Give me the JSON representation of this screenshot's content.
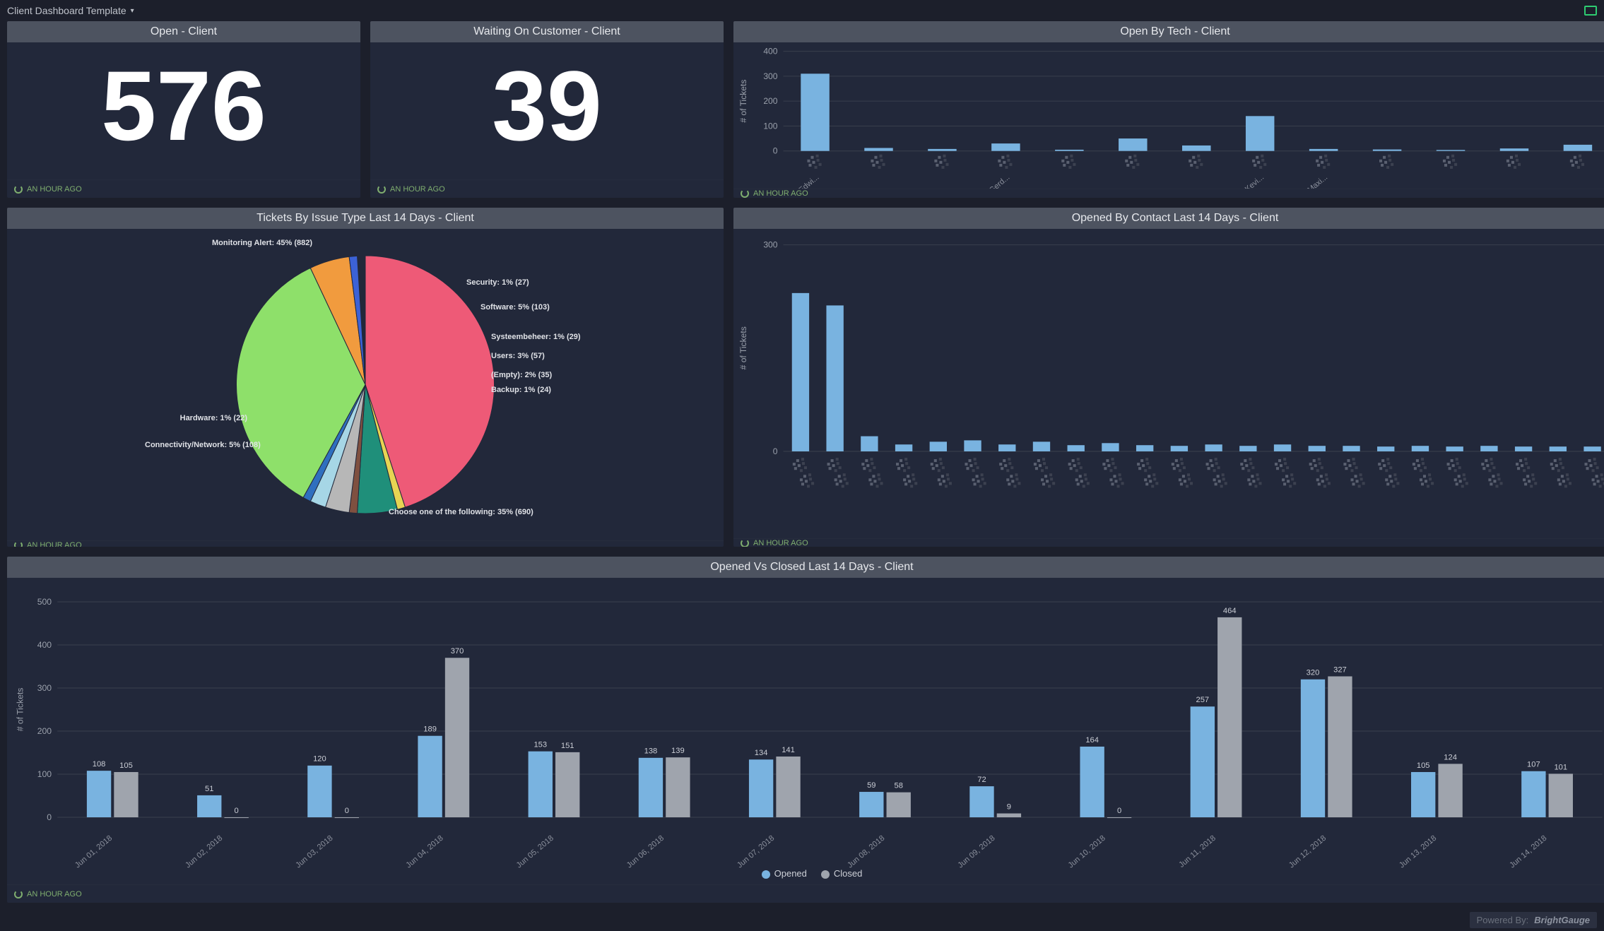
{
  "topbar": {
    "title": "Client Dashboard Template"
  },
  "footer_time": "AN HOUR AGO",
  "powered_by_label": "Powered By:",
  "powered_by_brand": "BrightGauge",
  "cards": {
    "open_client": {
      "title": "Open - Client",
      "value": "576"
    },
    "waiting": {
      "title": "Waiting On Customer - Client",
      "value": "39"
    },
    "open_by_tech": {
      "title": "Open By Tech - Client"
    },
    "issue_type": {
      "title": "Tickets By Issue Type Last 14 Days - Client"
    },
    "by_contact": {
      "title": "Opened By Contact Last 14 Days - Client"
    },
    "open_vs_closed": {
      "title": "Opened Vs Closed Last 14 Days - Client"
    }
  },
  "chart_data": [
    {
      "id": "open_by_tech",
      "type": "bar",
      "ylabel": "# of Tickets",
      "yticks": [
        0,
        100,
        200,
        300,
        400
      ],
      "ylim": [
        0,
        400
      ],
      "categories": [
        "Edwi...",
        "",
        "",
        "Gerd...",
        "",
        "",
        "",
        "Kevi...",
        "Maxi...",
        "",
        "",
        "",
        ""
      ],
      "values": [
        310,
        12,
        8,
        30,
        5,
        50,
        22,
        140,
        8,
        6,
        4,
        10,
        25
      ],
      "color": "#79b3e0"
    },
    {
      "id": "issue_type_pie",
      "type": "pie",
      "title": "Tickets By Issue Type Last 14 Days - Client",
      "slices": [
        {
          "label": "Monitoring Alert",
          "pct": 45,
          "count": 882,
          "color": "#ee5a77"
        },
        {
          "label": "Security",
          "pct": 1,
          "count": 27,
          "color": "#e7d453"
        },
        {
          "label": "Software",
          "pct": 5,
          "count": 103,
          "color": "#1f8f7a"
        },
        {
          "label": "Systeembeheer",
          "pct": 1,
          "count": 29,
          "color": "#7f5040"
        },
        {
          "label": "Users",
          "pct": 3,
          "count": 57,
          "color": "#b7b7b7"
        },
        {
          "label": "(Empty)",
          "pct": 2,
          "count": 35,
          "color": "#a6d6e6"
        },
        {
          "label": "Backup",
          "pct": 1,
          "count": 24,
          "color": "#2f6fbf"
        },
        {
          "label": "Choose one of the following",
          "pct": 35,
          "count": 690,
          "color": "#8ee06a"
        },
        {
          "label": "Connectivity/Network",
          "pct": 5,
          "count": 108,
          "color": "#f19b3e"
        },
        {
          "label": "Hardware",
          "pct": 1,
          "count": 22,
          "color": "#3c62d6"
        }
      ]
    },
    {
      "id": "by_contact",
      "type": "bar",
      "ylabel": "# of Tickets",
      "yticks": [
        0,
        300
      ],
      "ylim": [
        0,
        300
      ],
      "categories_count": 24,
      "values": [
        230,
        212,
        22,
        10,
        14,
        16,
        10,
        14,
        9,
        12,
        9,
        8,
        10,
        8,
        10,
        8,
        8,
        7,
        8,
        7,
        8,
        7,
        7,
        7
      ],
      "color": "#79b3e0"
    },
    {
      "id": "open_vs_closed",
      "type": "bar-grouped",
      "ylabel": "# of Tickets",
      "yticks": [
        0,
        100,
        200,
        300,
        400,
        500
      ],
      "ylim": [
        0,
        500
      ],
      "categories": [
        "Jun 01, 2018",
        "Jun 02, 2018",
        "Jun 03, 2018",
        "Jun 04, 2018",
        "Jun 05, 2018",
        "Jun 06, 2018",
        "Jun 07, 2018",
        "Jun 08, 2018",
        "Jun 09, 2018",
        "Jun 10, 2018",
        "Jun 11, 2018",
        "Jun 12, 2018",
        "Jun 13, 2018",
        "Jun 14, 2018"
      ],
      "series": [
        {
          "name": "Opened",
          "color": "#79b3e0",
          "values": [
            108,
            51,
            120,
            189,
            153,
            138,
            134,
            59,
            72,
            164,
            257,
            320,
            105,
            107
          ]
        },
        {
          "name": "Closed",
          "color": "#9fa4ad",
          "values": [
            105,
            0,
            0,
            370,
            151,
            139,
            141,
            58,
            9,
            0,
            464,
            327,
            124,
            101
          ]
        }
      ]
    }
  ],
  "pie_labels_text": {
    "monitoring": "Monitoring Alert: 45% (882)",
    "security": "Security: 1% (27)",
    "software": "Software: 5% (103)",
    "systeem": "Systeembeheer: 1% (29)",
    "users": "Users: 3% (57)",
    "empty": "(Empty): 2% (35)",
    "backup": "Backup: 1% (24)",
    "choose": "Choose one of the following: 35% (690)",
    "connectivity": "Connectivity/Network: 5% (108)",
    "hardware": "Hardware: 1% (22)"
  },
  "legend": {
    "opened": "Opened",
    "closed": "Closed"
  }
}
